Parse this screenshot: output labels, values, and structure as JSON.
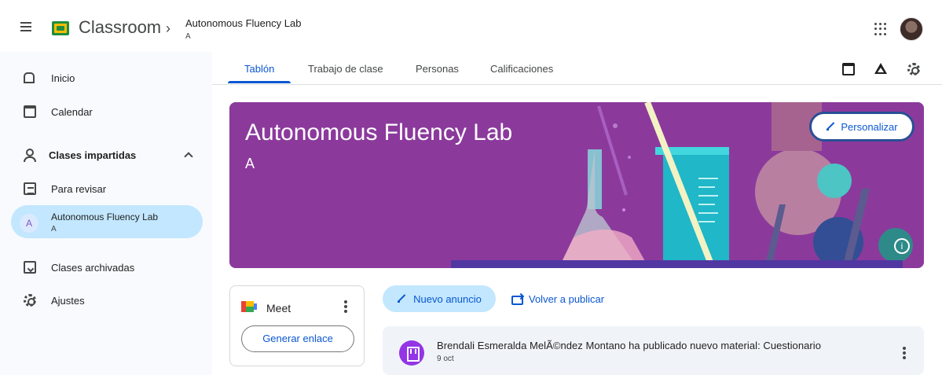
{
  "header": {
    "app_name": "Classroom",
    "breadcrumb_separator": "›",
    "class_title": "Autonomous Fluency Lab",
    "class_section": "A"
  },
  "sidebar": {
    "items": [
      {
        "label": "Inicio"
      },
      {
        "label": "Calendar"
      },
      {
        "label": "Clases impartidas"
      },
      {
        "label": "Para revisar"
      },
      {
        "label": "Autonomous Fluency Lab",
        "sublabel": "A",
        "avatar_letter": "A"
      },
      {
        "label": "Clases archivadas"
      },
      {
        "label": "Ajustes"
      }
    ]
  },
  "tabs": [
    {
      "label": "Tablón"
    },
    {
      "label": "Trabajo de clase"
    },
    {
      "label": "Personas"
    },
    {
      "label": "Calificaciones"
    }
  ],
  "banner": {
    "title": "Autonomous Fluency Lab",
    "section": "A",
    "customize_label": "Personalizar"
  },
  "meet": {
    "title": "Meet",
    "generate_link_label": "Generar enlace"
  },
  "stream": {
    "new_announcement_label": "Nuevo anuncio",
    "repost_label": "Volver a publicar",
    "activity": {
      "text": "Brendali Esmeralda MelÃ©ndez Montano ha publicado nuevo material: Cuestionario",
      "date": "9 oct"
    }
  },
  "icons": {
    "menu": "menu-icon",
    "logo": "classroom-logo",
    "apps": "apps-grid-icon",
    "avatar": "user-avatar",
    "calendar": "calendar-icon",
    "drive": "drive-icon",
    "settings": "gear-icon",
    "info": "info-icon"
  },
  "colors": {
    "accent": "#0b57d0",
    "selected_background": "#c2e7ff",
    "banner_background": "#8b3a9c",
    "material_icon": "#9334e6"
  }
}
